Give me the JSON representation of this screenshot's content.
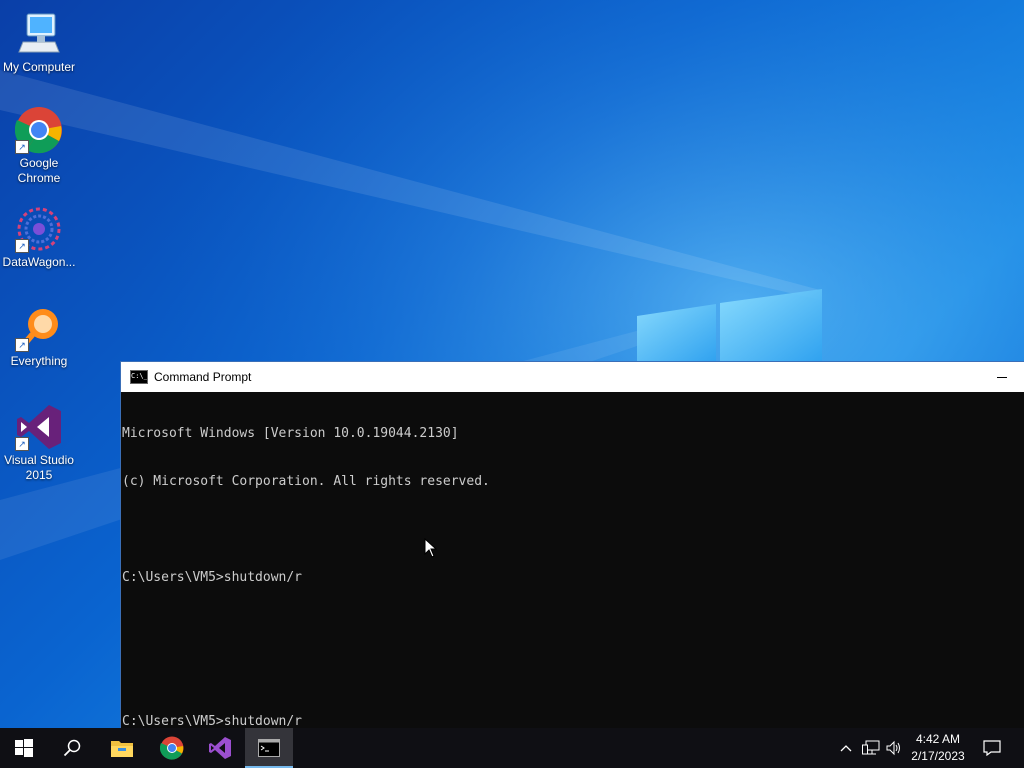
{
  "desktop": {
    "icons": [
      {
        "label": "My Computer"
      },
      {
        "label": "Google Chrome"
      },
      {
        "label": "DataWagon..."
      },
      {
        "label": "Everything"
      },
      {
        "label": "Visual Studio 2015"
      }
    ]
  },
  "cmd_window": {
    "title": "Command Prompt",
    "lines": [
      "Microsoft Windows [Version 10.0.19044.2130]",
      "(c) Microsoft Corporation. All rights reserved.",
      "",
      "C:\\Users\\VM5>shutdown/r",
      "",
      "",
      "C:\\Users\\VM5>shutdown/r"
    ]
  },
  "taskbar": {
    "clock_time": "4:42 AM",
    "clock_date": "2/17/2023",
    "pinned": [
      "start-icon",
      "search-icon",
      "file-explorer-icon",
      "chrome-icon",
      "visual-studio-icon",
      "command-prompt-icon"
    ]
  },
  "colors": {
    "desktop_blue": "#0a64d0",
    "console_bg": "#0c0c0c",
    "console_fg": "#cccccc",
    "taskbar_bg": "#0f0f14",
    "accent": "#76b9ed"
  }
}
